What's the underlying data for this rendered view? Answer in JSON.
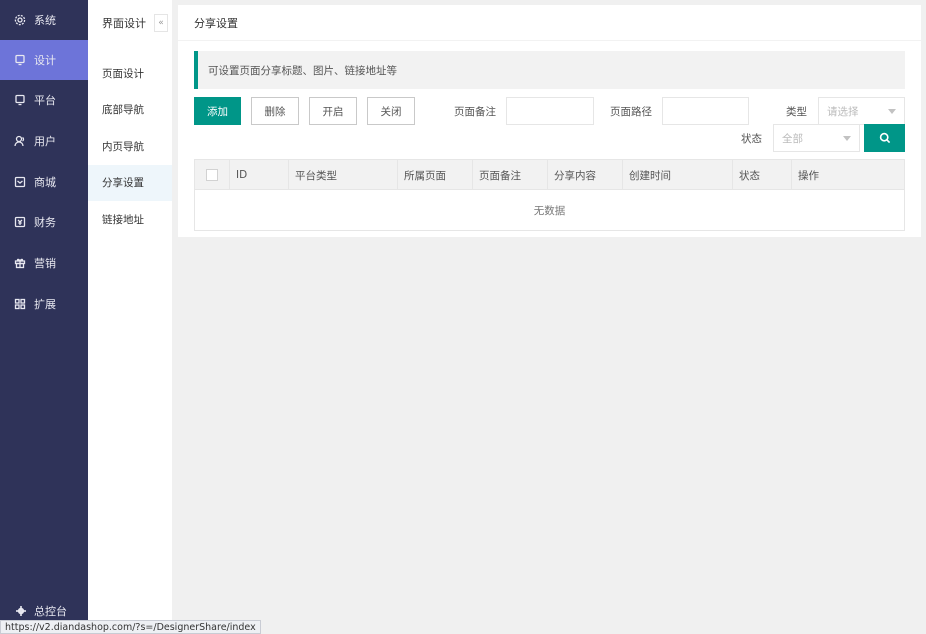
{
  "sidebar": {
    "items": [
      {
        "label": "系统",
        "icon": "gear-icon"
      },
      {
        "label": "设计",
        "icon": "monitor-icon"
      },
      {
        "label": "平台",
        "icon": "monitor-icon"
      },
      {
        "label": "用户",
        "icon": "user-icon"
      },
      {
        "label": "商城",
        "icon": "mail-icon"
      },
      {
        "label": "财务",
        "icon": "finance-icon"
      },
      {
        "label": "营销",
        "icon": "gift-icon"
      },
      {
        "label": "扩展",
        "icon": "grid-icon"
      }
    ],
    "active_index": 1,
    "bottom_label": "总控台",
    "accent": "#6d74d9",
    "bg": "#2f3359"
  },
  "submenu": {
    "title": "界面设计",
    "collapse_glyph": "«",
    "items": [
      "页面设计",
      "底部导航",
      "内页导航",
      "分享设置",
      "链接地址"
    ],
    "active_index": 3
  },
  "main": {
    "title": "分享设置",
    "tip": "可设置页面分享标题、图片、链接地址等",
    "buttons": {
      "add": "添加",
      "delete": "删除",
      "enable": "开启",
      "close": "关闭"
    },
    "filters": {
      "remark_label": "页面备注",
      "path_label": "页面路径",
      "type_label": "类型",
      "type_placeholder": "请选择",
      "status_label": "状态",
      "status_value": "全部"
    },
    "table": {
      "columns": [
        "ID",
        "平台类型",
        "所属页面",
        "页面备注",
        "分享内容",
        "创建时间",
        "状态",
        "操作"
      ],
      "empty_text": "无数据"
    },
    "primary_color": "#009688"
  },
  "statusbar": {
    "url": "https://v2.diandashop.com/?s=/DesignerShare/index"
  }
}
